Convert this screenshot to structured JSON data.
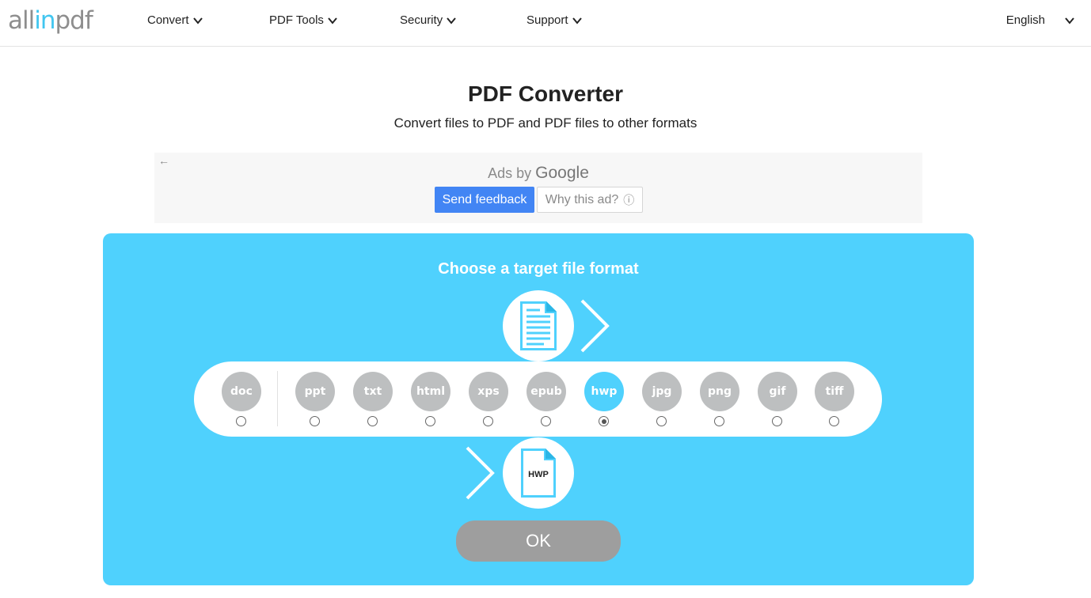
{
  "header": {
    "logo": {
      "part1": "all",
      "part2": "in",
      "part3": "pdf"
    },
    "nav": [
      {
        "label": "Convert"
      },
      {
        "label": "PDF Tools"
      },
      {
        "label": "Security"
      },
      {
        "label": "Support"
      }
    ],
    "language": "English"
  },
  "page": {
    "title": "PDF Converter",
    "subtitle": "Convert files to PDF and PDF files to other formats"
  },
  "ad": {
    "label_prefix": "Ads by",
    "label_brand": "Google",
    "send_feedback": "Send feedback",
    "why_this_ad": "Why this ad?",
    "back_icon": "←",
    "info_icon": "ⓘ"
  },
  "converter": {
    "title": "Choose a target file format",
    "formats": [
      {
        "label": "doc",
        "selected": false
      },
      {
        "label": "ppt",
        "selected": false
      },
      {
        "label": "txt",
        "selected": false
      },
      {
        "label": "html",
        "selected": false
      },
      {
        "label": "xps",
        "selected": false
      },
      {
        "label": "epub",
        "selected": false
      },
      {
        "label": "hwp",
        "selected": true
      },
      {
        "label": "jpg",
        "selected": false
      },
      {
        "label": "png",
        "selected": false
      },
      {
        "label": "gif",
        "selected": false
      },
      {
        "label": "tiff",
        "selected": false
      }
    ],
    "target_icon_label": "HWP",
    "ok_label": "OK"
  },
  "colors": {
    "accent": "#4fd1fd",
    "logo_accent": "#41c6f0",
    "format_inactive": "#bdbfc0",
    "ok_button": "#9e9e9e",
    "feedback_button": "#4285f4"
  }
}
